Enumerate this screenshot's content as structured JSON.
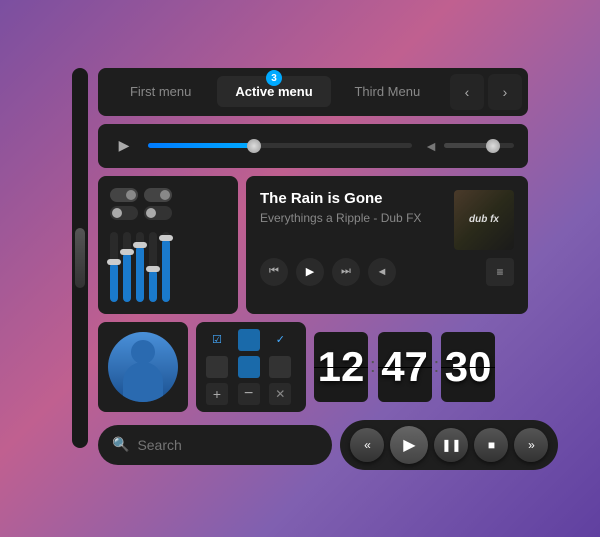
{
  "tabs": {
    "items": [
      {
        "label": "First menu",
        "active": false
      },
      {
        "label": "Active menu",
        "active": true
      },
      {
        "label": "Third Menu",
        "active": false
      }
    ],
    "badge": "3",
    "prev_label": "‹",
    "next_label": "›"
  },
  "player": {
    "progress": 40,
    "volume": 70
  },
  "track": {
    "title": "The Rain is Gone",
    "artist": "Everythings a Ripple - Dub FX",
    "album_label": "dub fx"
  },
  "clock": {
    "hours": "12",
    "minutes": "47",
    "seconds": "30"
  },
  "search": {
    "placeholder": "Search"
  },
  "playback": {
    "rewind": "«",
    "play": "▶",
    "pause": "❚❚",
    "stop": "■",
    "forward": "»"
  }
}
